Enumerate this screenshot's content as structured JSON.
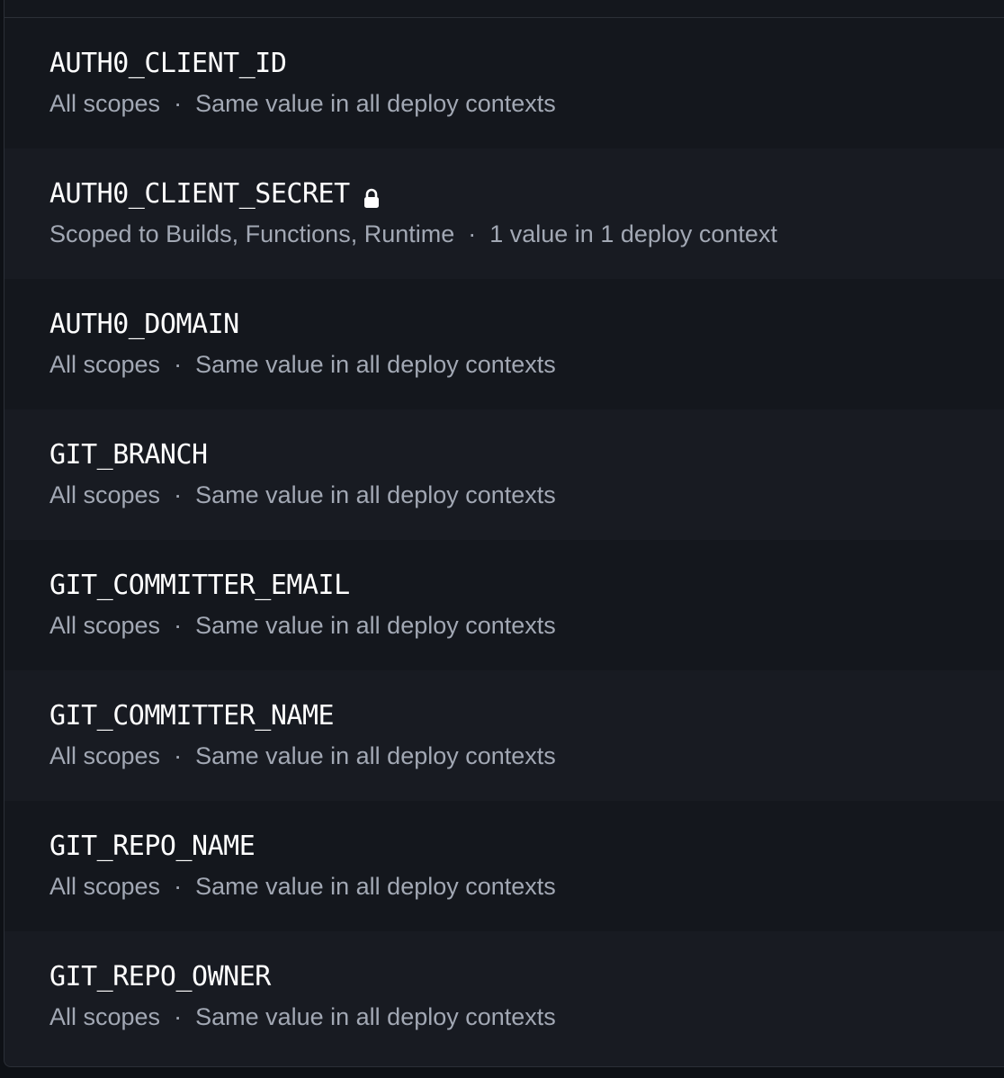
{
  "variables": [
    {
      "name": "AUTH0_CLIENT_ID",
      "scope": "All scopes",
      "context": "Same value in all deploy contexts",
      "secret": false
    },
    {
      "name": "AUTH0_CLIENT_SECRET",
      "scope": "Scoped to Builds, Functions, Runtime",
      "context": "1 value in 1 deploy context",
      "secret": true
    },
    {
      "name": "AUTH0_DOMAIN",
      "scope": "All scopes",
      "context": "Same value in all deploy contexts",
      "secret": false
    },
    {
      "name": "GIT_BRANCH",
      "scope": "All scopes",
      "context": "Same value in all deploy contexts",
      "secret": false
    },
    {
      "name": "GIT_COMMITTER_EMAIL",
      "scope": "All scopes",
      "context": "Same value in all deploy contexts",
      "secret": false
    },
    {
      "name": "GIT_COMMITTER_NAME",
      "scope": "All scopes",
      "context": "Same value in all deploy contexts",
      "secret": false
    },
    {
      "name": "GIT_REPO_NAME",
      "scope": "All scopes",
      "context": "Same value in all deploy contexts",
      "secret": false
    },
    {
      "name": "GIT_REPO_OWNER",
      "scope": "All scopes",
      "context": "Same value in all deploy contexts",
      "secret": false
    }
  ],
  "separator": "·",
  "icons": {
    "secret": "lock-icon"
  },
  "colors": {
    "row_dark": "#14171d",
    "row_light": "#181b22",
    "name_text": "#ffffff",
    "meta_text": "#a2a8b4"
  }
}
